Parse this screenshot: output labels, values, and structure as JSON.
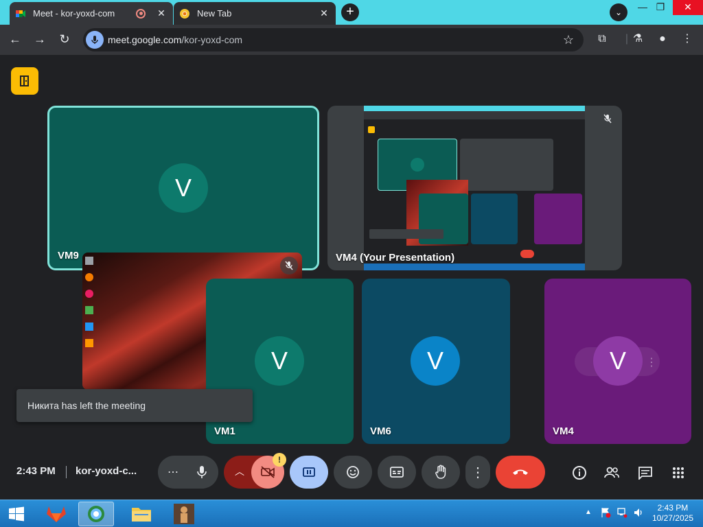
{
  "browser": {
    "tabs": [
      {
        "title": "Meet - kor-yoxd-com",
        "active": true
      },
      {
        "title": "New Tab",
        "active": false
      }
    ],
    "url_host": "meet.google.com",
    "url_path": "/kor-yoxd-com"
  },
  "meeting": {
    "tiles": [
      {
        "name": "VM9",
        "initial": "V",
        "color": "#0b5c54"
      },
      {
        "name": "VM4 (Your Presentation)",
        "initial": ""
      },
      {
        "name": "VM1",
        "initial": "V",
        "color": "#0b5c54"
      },
      {
        "name": "VM6",
        "initial": "V",
        "color": "#0c4a63"
      },
      {
        "name": "VM4",
        "initial": "V",
        "color": "#6a1b7a"
      }
    ],
    "toast": "Никита has left the meeting",
    "time": "2:43 PM",
    "code": "kor-yoxd-c...",
    "camera_warning": "!"
  },
  "taskbar": {
    "time": "2:43 PM",
    "date": "10/27/2025"
  },
  "colors": {
    "accent_border": "#81e4da",
    "end_call": "#ea4335",
    "present_active": "#a8c7fa"
  }
}
